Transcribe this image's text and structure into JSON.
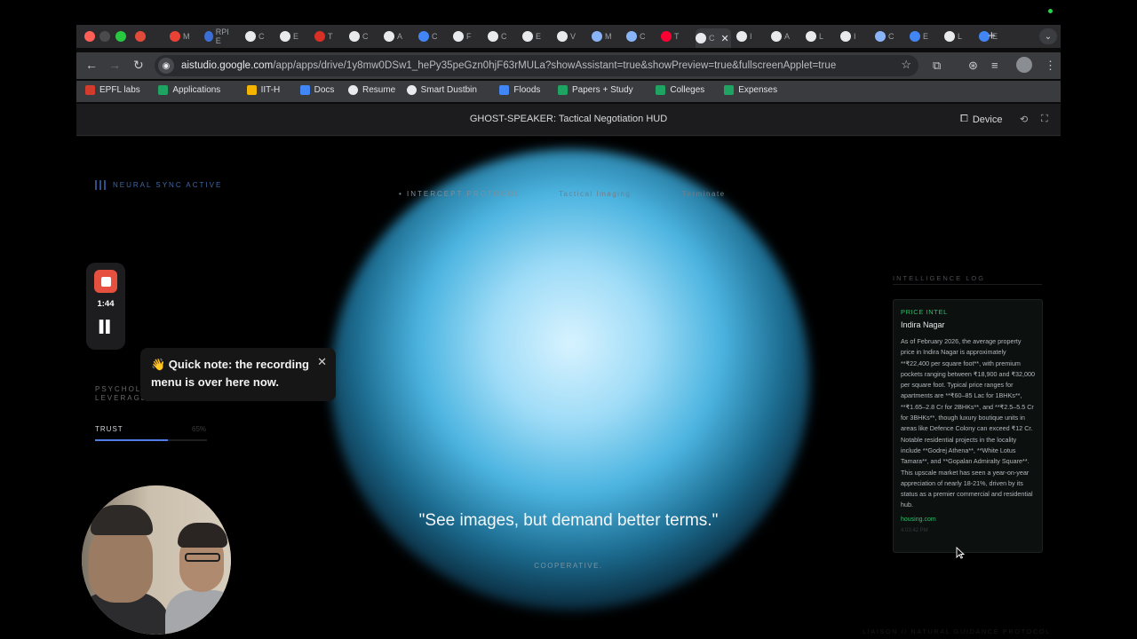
{
  "browser": {
    "tabs": [
      {
        "icon": "circle-icon",
        "label": "",
        "color": "#e24a3a"
      },
      {
        "icon": "gmail-icon",
        "label": "M",
        "color": "#ea4335"
      },
      {
        "icon": "rpi-icon",
        "label": "RPI E",
        "color": "#3c6fd6"
      },
      {
        "icon": "github-icon",
        "label": "C",
        "color": "#e8eaed"
      },
      {
        "icon": "chrome-icon",
        "label": "E",
        "color": "#e8eaed"
      },
      {
        "icon": "k-icon",
        "label": "T",
        "color": "#d93025"
      },
      {
        "icon": "github-icon",
        "label": "C",
        "color": "#e8eaed"
      },
      {
        "icon": "google-icon",
        "label": "A",
        "color": "#e8eaed"
      },
      {
        "icon": "app-icon",
        "label": "C",
        "color": "#4285f4"
      },
      {
        "icon": "flask-icon",
        "label": "F",
        "color": "#e8eaed"
      },
      {
        "icon": "openai-icon",
        "label": "C",
        "color": "#e8eaed"
      },
      {
        "icon": "square-icon",
        "label": "E",
        "color": "#e8eaed"
      },
      {
        "icon": "shield-icon",
        "label": "V",
        "color": "#e8eaed"
      },
      {
        "icon": "feather-icon",
        "label": "M",
        "color": "#8ab4f8"
      },
      {
        "icon": "gemini-icon",
        "label": "C",
        "color": "#8ab4f8"
      },
      {
        "icon": "youtube-icon",
        "label": "T",
        "color": "#ff0033"
      },
      {
        "icon": "aistudio-icon",
        "label": "C",
        "color": "#e8eaed",
        "active": true
      },
      {
        "icon": "google-icon",
        "label": "I",
        "color": "#e8eaed"
      },
      {
        "icon": "google-icon",
        "label": "A",
        "color": "#e8eaed"
      },
      {
        "icon": "globe-icon",
        "label": "L",
        "color": "#e8eaed"
      },
      {
        "icon": "github-icon",
        "label": "I",
        "color": "#e8eaed"
      },
      {
        "icon": "gemini-icon",
        "label": "C",
        "color": "#8ab4f8"
      },
      {
        "icon": "app-icon",
        "label": "E",
        "color": "#4285f4"
      },
      {
        "icon": "doc-icon",
        "label": "L",
        "color": "#e8eaed"
      },
      {
        "icon": "app-icon",
        "label": "E",
        "color": "#4285f4"
      }
    ],
    "url_host": "aistudio.google.com",
    "url_path": "/app/apps/drive/1y8mw0DSw1_hePy35peGzn0hjF63rMULa?showAssistant=true&showPreview=true&fullscreenApplet=true",
    "bookmarks": [
      {
        "label": "EPFL labs",
        "icon": "epfl-icon",
        "color": "#d33b2c"
      },
      {
        "label": "Applications",
        "icon": "sheets-icon",
        "color": "#1ea362"
      },
      {
        "label": "IIT-H",
        "icon": "drive-icon",
        "color": "#f4b400"
      },
      {
        "label": "Docs",
        "icon": "docs-icon",
        "color": "#4285f4"
      },
      {
        "label": "Resume",
        "icon": "chrome-icon",
        "color": "#e8eaed"
      },
      {
        "label": "Smart Dustbin",
        "icon": "chrome-icon",
        "color": "#e8eaed"
      },
      {
        "label": "Floods",
        "icon": "docs-icon",
        "color": "#4285f4"
      },
      {
        "label": "Papers + Study",
        "icon": "sheets-icon",
        "color": "#1ea362"
      },
      {
        "label": "Colleges",
        "icon": "sheets-icon",
        "color": "#1ea362"
      },
      {
        "label": "Expenses",
        "icon": "sheets-icon",
        "color": "#1ea362"
      }
    ]
  },
  "app_header": {
    "title": "GHOST-SPEAKER: Tactical Negotiation HUD",
    "device_label": "Device"
  },
  "hud": {
    "status": "NEURAL SYNC ACTIVE",
    "nav": {
      "intercept": "INTERCEPT PROTOCOL",
      "imaging": "Tactical Imaging",
      "terminate": "Terminate"
    },
    "psych_label_line1": "PSYCHOL",
    "psych_label_line2": "LEVERAGE",
    "trust_label": "TRUST",
    "trust_pct_label": "65%",
    "trust_value": 0.65,
    "quote": "\"See images, but demand better terms.\"",
    "mode": "COOPERATIVE.",
    "intel_title": "INTELLIGENCE LOG",
    "card": {
      "category": "PRICE INTEL",
      "title": "Indira Nagar",
      "body": "As of February 2026, the average property price in Indira Nagar is approximately **₹22,400 per square foot**, with premium pockets ranging between ₹18,900 and ₹32,000 per square foot. Typical price ranges for apartments are **₹60–85 Lac for 1BHKs**, **₹1.65–2.8 Cr for 2BHKs**, and **₹2.5–5.5 Cr for 3BHKs**, though luxury boutique units in areas like Defence Colony can exceed ₹12 Cr. Notable residential projects in the locality include **Godrej Athena**, **White Lotus Tamara**, and **Gopalan Admiralty Square**. This upscale market has seen a year-on-year appreciation of nearly 18-21%, driven by its status as a premier commercial and residential hub.",
      "source": "housing.com",
      "time": "4:03:42 PM"
    },
    "footer": "LIAISON // NATURAL GUIDANCE PROTOCOL"
  },
  "recorder": {
    "time": "1:44",
    "note": "👋 Quick note: the recording menu is over here now."
  },
  "colors": {
    "accent_blue": "#4f7ce6",
    "intel_green": "#2fbf6a",
    "record_red": "#e6503f"
  }
}
